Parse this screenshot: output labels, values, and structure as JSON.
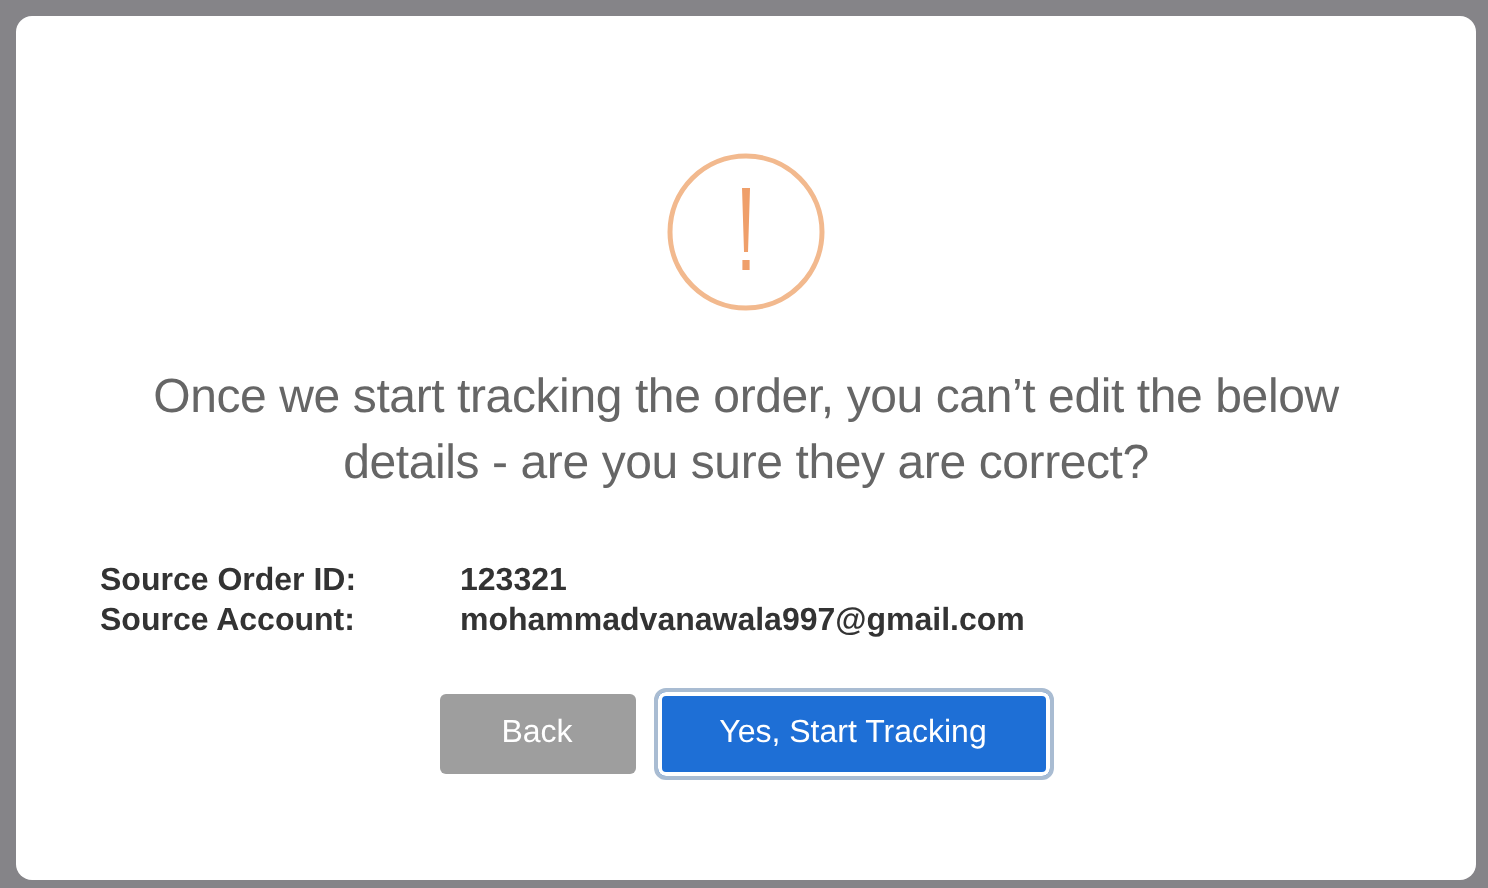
{
  "dialog": {
    "message": "Once we start tracking the order, you can’t edit the below details - are you sure they are correct?",
    "details": [
      {
        "label": "Source Order ID:",
        "value": "123321"
      },
      {
        "label": "Source Account:",
        "value": "mohammadvanawala997@gmail.com"
      }
    ],
    "buttons": [
      {
        "label": "Back",
        "kind": "secondary",
        "focused": false
      },
      {
        "label": "Yes, Start Tracking",
        "kind": "primary",
        "focused": true
      }
    ]
  }
}
